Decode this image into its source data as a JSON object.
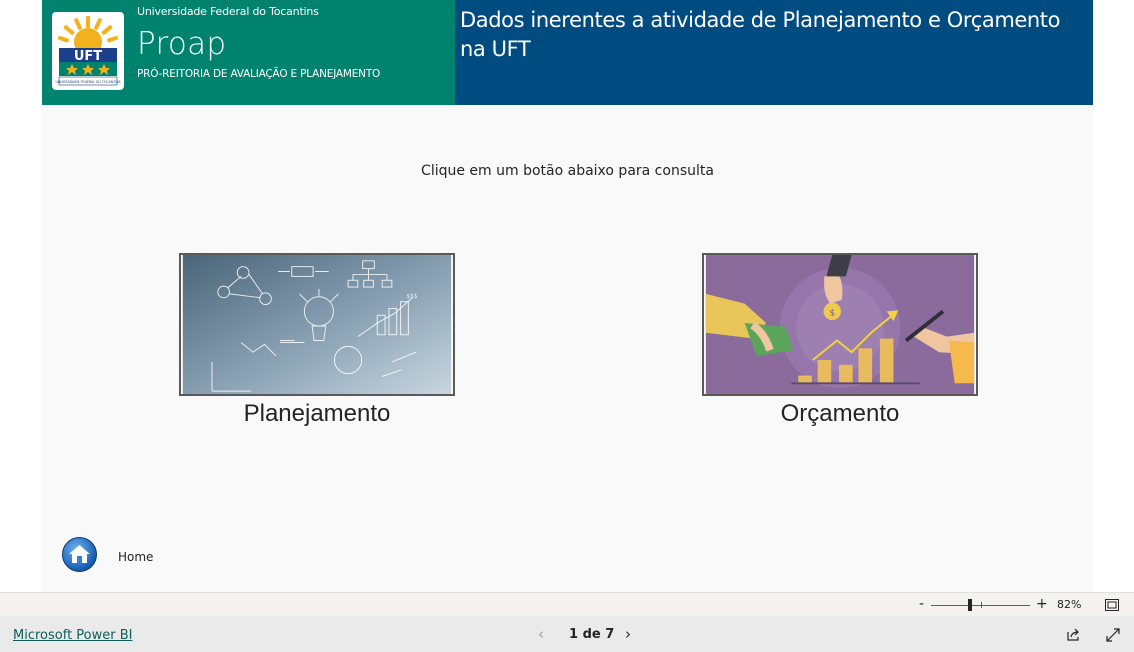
{
  "header": {
    "university": "Universidade Federal do Tocantins",
    "app_name": "Proap",
    "app_subtitle": "PRÓ-REITORIA DE AVALIAÇÃO E PLANEJAMENTO",
    "report_title": "Dados inerentes a atividade de Planejamento e Orçamento na UFT",
    "logo_text": "UFT",
    "logo_caption": "UNIVERSIDADE FEDERAL DO TOCANTINS",
    "colors": {
      "green": "#00836e",
      "blue": "#004b80"
    }
  },
  "main": {
    "instruction": "Clique em um botão abaixo para consulta",
    "buttons": [
      {
        "label": "Planejamento",
        "image_icon": "planning-sketch-image"
      },
      {
        "label": "Orçamento",
        "image_icon": "budget-growth-image"
      }
    ],
    "home_label": "Home",
    "home_icon": "home-icon"
  },
  "zoom": {
    "minus": "-",
    "plus": "+",
    "level": "82%",
    "value_percent": 82
  },
  "footer": {
    "powerbi_link": "Microsoft Power BI",
    "page_indicator": "1 de 7",
    "prev_icon": "chevron-left-icon",
    "next_icon": "chevron-right-icon",
    "share_icon": "share-icon",
    "fullscreen_icon": "fullscreen-icon"
  }
}
